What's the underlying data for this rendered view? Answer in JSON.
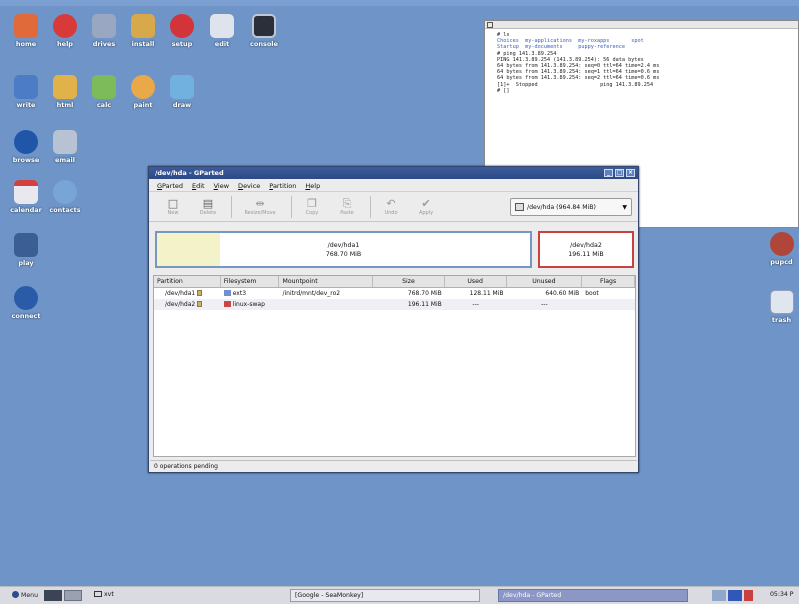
{
  "desktop": {
    "icons": [
      {
        "label": "home",
        "glyph": "home-icon",
        "color": "#e06a3a"
      },
      {
        "label": "help",
        "glyph": "help-icon",
        "color": "#d83a3a"
      },
      {
        "label": "drives",
        "glyph": "drives-icon",
        "color": "#9aa7c2"
      },
      {
        "label": "install",
        "glyph": "install-icon",
        "color": "#d7a94a"
      },
      {
        "label": "setup",
        "glyph": "setup-icon",
        "color": "#d2343a"
      },
      {
        "label": "edit",
        "glyph": "edit-icon",
        "color": "#dfe4ec"
      },
      {
        "label": "console",
        "glyph": "console-icon",
        "color": "#2a2f3a"
      },
      {
        "label": "write",
        "glyph": "write-icon",
        "color": "#4d7cc6"
      },
      {
        "label": "html",
        "glyph": "html-icon",
        "color": "#e2b24a"
      },
      {
        "label": "calc",
        "glyph": "calc-icon",
        "color": "#7dbb5a"
      },
      {
        "label": "paint",
        "glyph": "paint-icon",
        "color": "#e9a948"
      },
      {
        "label": "draw",
        "glyph": "draw-icon",
        "color": "#71b1df"
      },
      {
        "label": "browse",
        "glyph": "globe-icon",
        "color": "#1f56a8"
      },
      {
        "label": "email",
        "glyph": "email-icon",
        "color": "#b7c3d3"
      },
      {
        "label": "calendar",
        "glyph": "calendar-icon",
        "color": "#e8e8ee"
      },
      {
        "label": "contacts",
        "glyph": "contacts-icon",
        "color": "#78a4d8"
      },
      {
        "label": "play",
        "glyph": "play-icon",
        "color": "#3b5f95"
      },
      {
        "label": "connect",
        "glyph": "connect-icon",
        "color": "#2a5ba8"
      },
      {
        "label": "pupcd",
        "glyph": "cd-icon",
        "color": "#b0453a"
      },
      {
        "label": "trash",
        "glyph": "trash-icon",
        "color": "#dfe6f0"
      }
    ]
  },
  "terminal": {
    "lines": [
      "# ls",
      "Choices  my-applications  my-roxapps       spot",
      "Startup  my-documents     puppy-reference",
      "# ping 141.3.89.254",
      "PING 141.3.89.254 (141.3.89.254): 56 data bytes",
      "64 bytes from 141.3.89.254: seq=0 ttl=64 time=2.4 ms",
      "64 bytes from 141.3.89.254: seq=1 ttl=64 time=0.6 ms",
      "64 bytes from 141.3.89.254: seq=2 ttl=64 time=0.6 ms",
      "",
      "[1]+  Stopped                    ping 141.3.89.254",
      "# []"
    ]
  },
  "gparted": {
    "title": "/dev/hda - GParted",
    "menu": [
      "GParted",
      "Edit",
      "View",
      "Device",
      "Partition",
      "Help"
    ],
    "toolbar": [
      {
        "label": "New",
        "glyph": "□"
      },
      {
        "label": "Delete",
        "glyph": "▤"
      },
      {
        "label": "Resize/Move",
        "glyph": "⇹"
      },
      {
        "label": "Copy",
        "glyph": "❐"
      },
      {
        "label": "Paste",
        "glyph": "⎘"
      },
      {
        "label": "Undo",
        "glyph": "↶"
      },
      {
        "label": "Apply",
        "glyph": "✔"
      }
    ],
    "device": "/dev/hda  (964.84 MiB)",
    "map": {
      "p1_name": "/dev/hda1",
      "p1_size": "768.70 MiB",
      "p1_used_fraction": 0.17,
      "p2_name": "/dev/hda2",
      "p2_size": "196.11 MiB"
    },
    "columns": [
      "Partition",
      "Filesystem",
      "Mountpoint",
      "Size",
      "Used",
      "Unused",
      "Flags"
    ],
    "rows": [
      {
        "partition": "/dev/hda1",
        "fs": "ext3",
        "fs_color": "#6f8fcf",
        "mount": "/initrd/mnt/dev_ro2",
        "size": "768.70 MiB",
        "used": "128.11 MiB",
        "unused": "640.60 MiB",
        "flags": "boot"
      },
      {
        "partition": "/dev/hda2",
        "fs": "linux-swap",
        "fs_color": "#c84848",
        "mount": "",
        "size": "196.11 MiB",
        "used": "---",
        "unused": "---",
        "flags": ""
      }
    ],
    "status": "0 operations pending"
  },
  "taskbar": {
    "menu": "Menu",
    "tasks": [
      {
        "label": "[Google - SeaMonkey]"
      },
      {
        "label": "/dev/hda - GParted"
      }
    ],
    "text_tab": "xvt",
    "clock": "05:34 P"
  }
}
